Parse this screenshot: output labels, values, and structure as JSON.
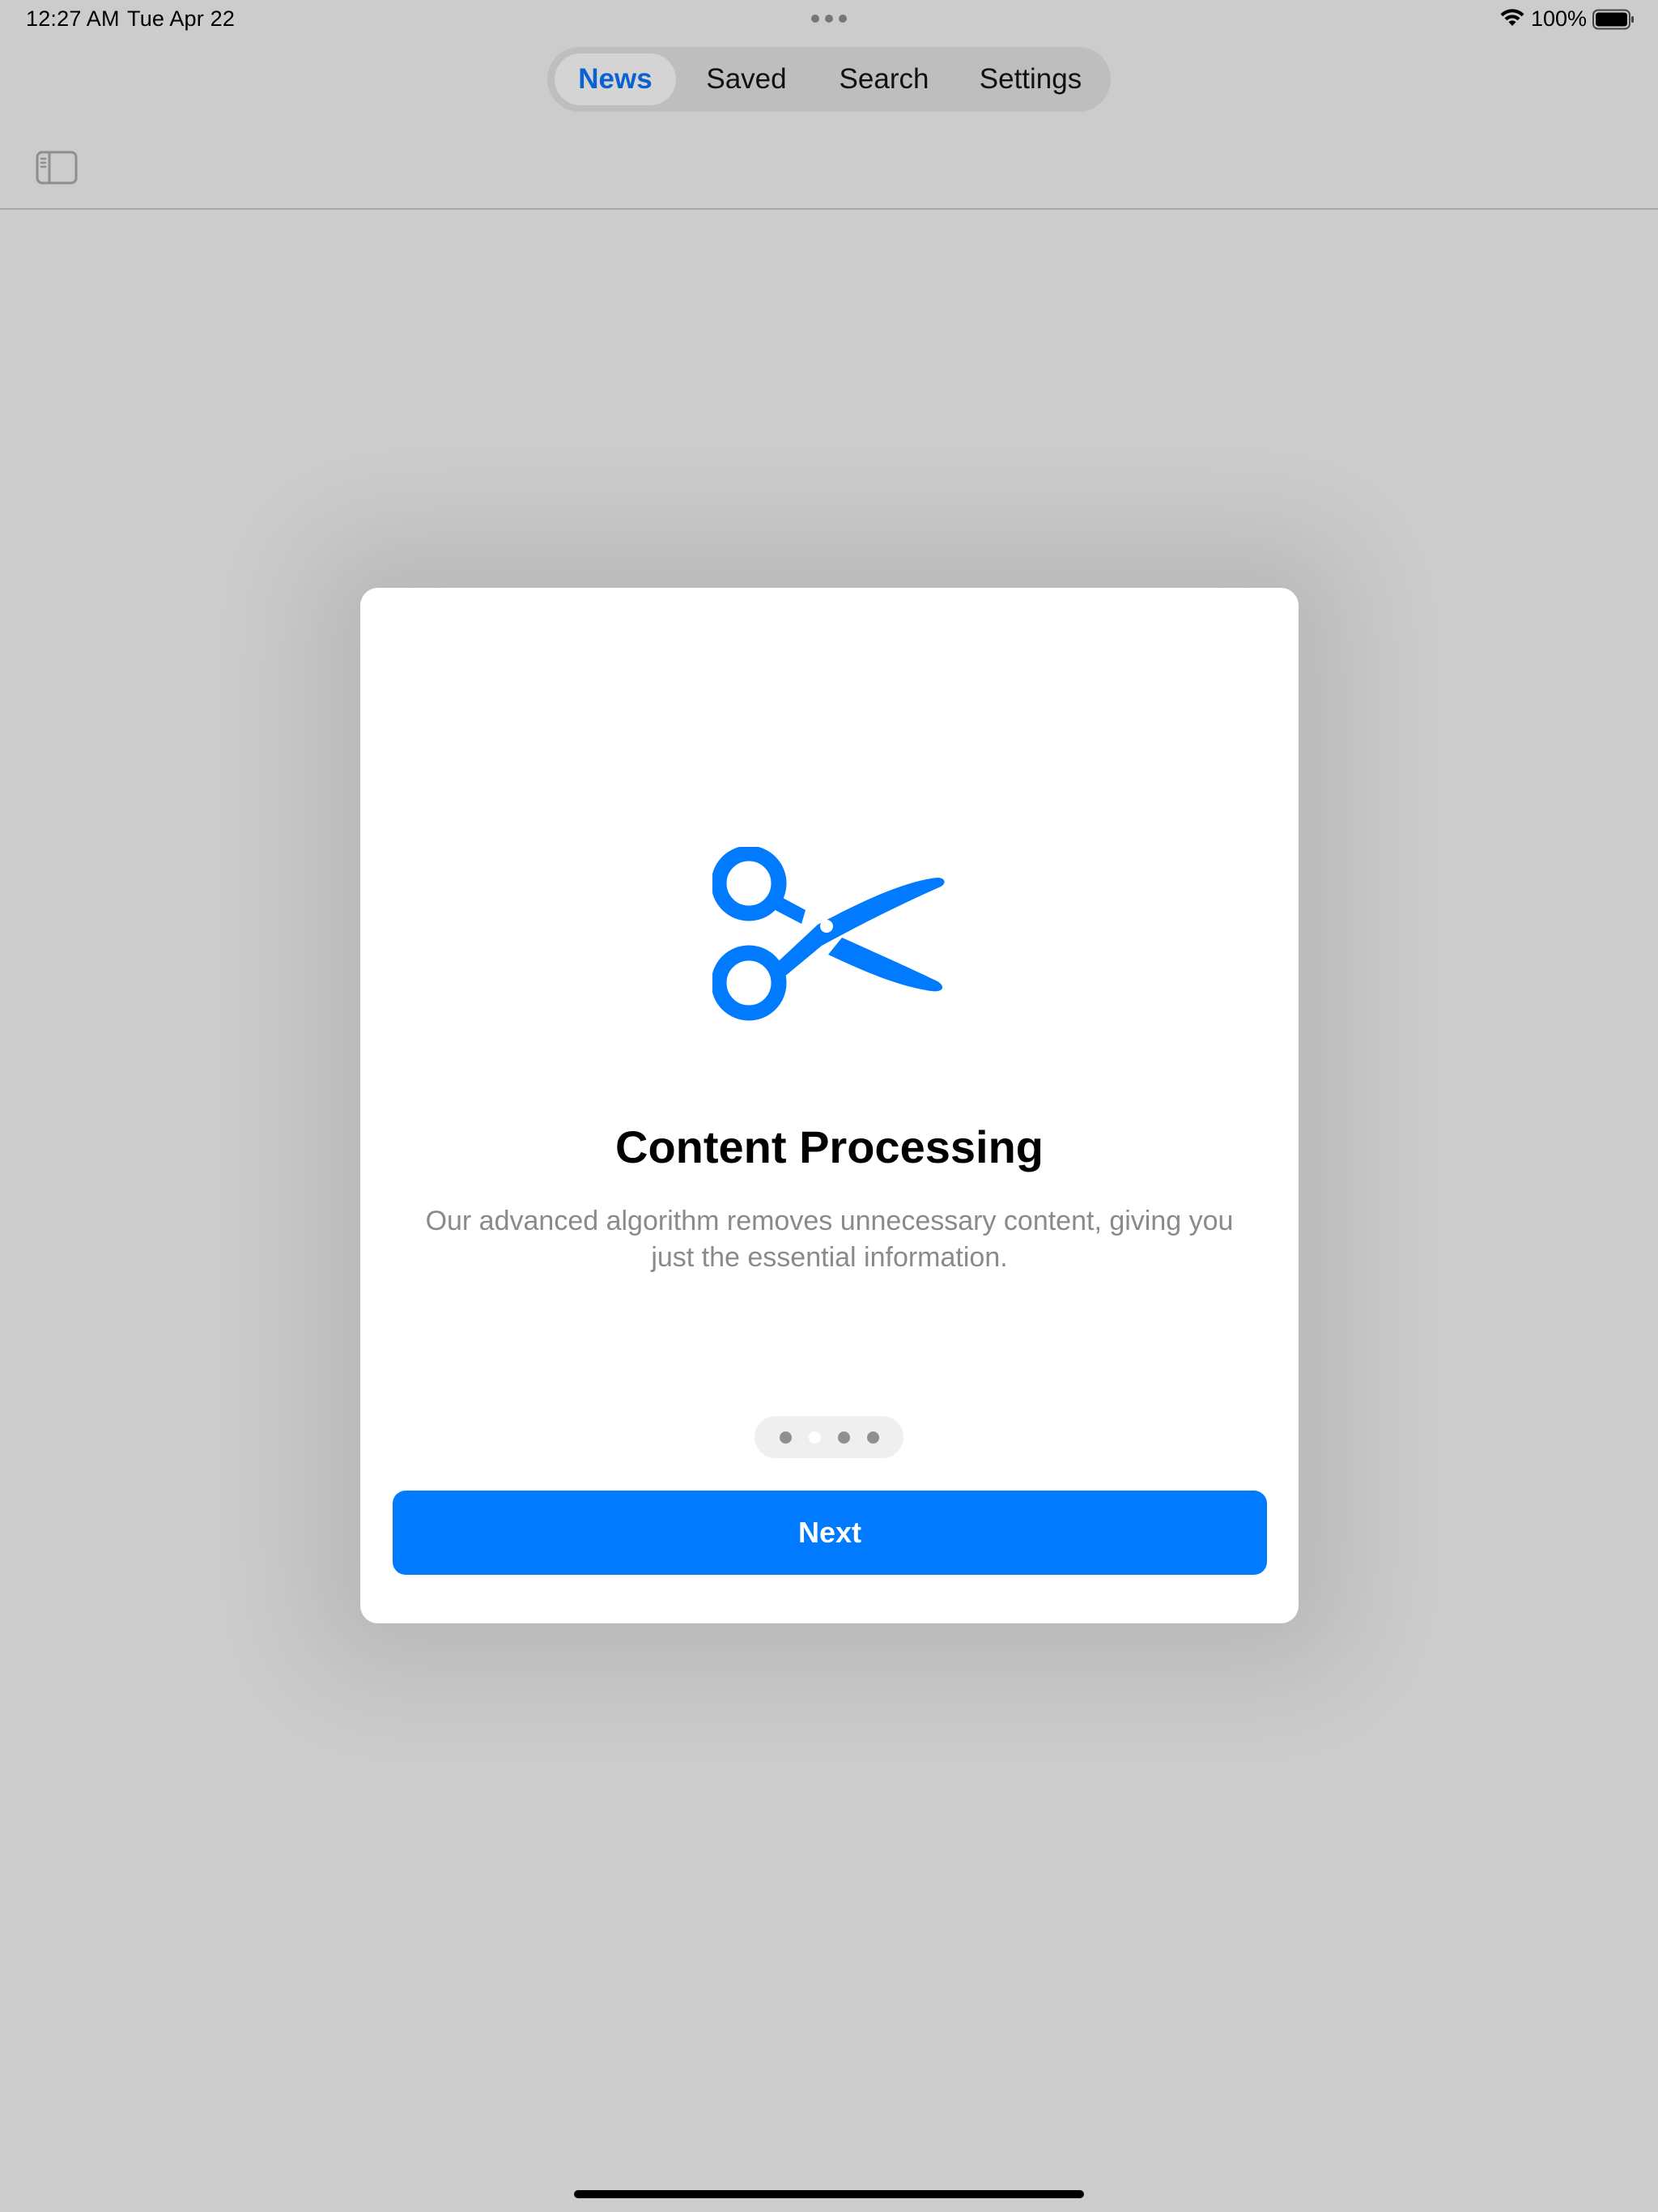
{
  "status_bar": {
    "time": "12:27 AM",
    "date": "Tue Apr 22",
    "battery": "100%"
  },
  "tabs": [
    {
      "label": "News",
      "active": true
    },
    {
      "label": "Saved",
      "active": false
    },
    {
      "label": "Search",
      "active": false
    },
    {
      "label": "Settings",
      "active": false
    }
  ],
  "onboarding": {
    "icon": "scissors-icon",
    "title": "Content Processing",
    "description": "Our advanced algorithm removes unnecessary content, giving you just the essential information.",
    "page_count": 4,
    "current_page": 2,
    "next_label": "Next"
  },
  "colors": {
    "accent": "#007aff",
    "active_tab_text": "#0a62d0",
    "description_text": "#8a8a8e",
    "backdrop": "#cccccc"
  }
}
